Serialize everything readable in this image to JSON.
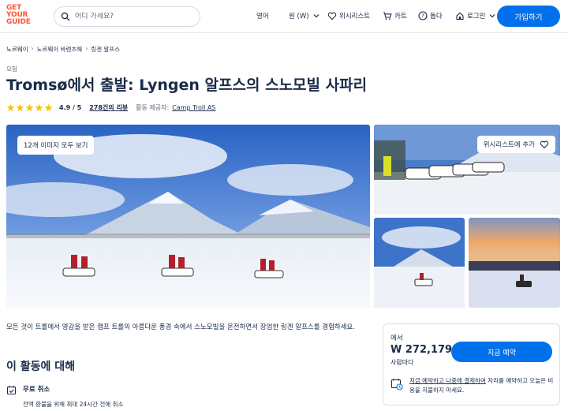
{
  "header": {
    "logo_lines": [
      "GET",
      "YOUR",
      "GUIDE"
    ],
    "search_placeholder": "어디 가세요?",
    "language": "영어",
    "currency": "원 (W)",
    "wishlist": "위시리스트",
    "cart": "카트",
    "help": "돕다",
    "login": "로그인",
    "signup": "가입하기",
    "brand_color": "#ff5533",
    "accent_color": "#0071eb"
  },
  "breadcrumb": [
    "노르웨이",
    "노르웨이 바렌츠해",
    "링겐 알프스"
  ],
  "activity": {
    "category": "모험",
    "title": "Tromsø에서 출발: Lyngen 알프스의 스노모빌 사파리",
    "rating": "4.9 / 5",
    "stars": 5,
    "reviews": "278건의 리뷰",
    "provider_label": "활동 제공자:",
    "provider": "Camp Troll AS"
  },
  "gallery": {
    "view_all": "12개 이미지 모두 보기",
    "wishlist_add": "위시리스트에 추가"
  },
  "description": "모든 것이 트롤에서 영감을 받은 캠프 트롤의 아름다운 풍경 속에서 스노모빌을 운전하면서 장엄한 링겐 알프스를 경험하세요.",
  "about": {
    "title": "이 활동에 대해",
    "features": [
      {
        "icon": "calendar-check-icon",
        "title": "무료 취소",
        "desc": "전액 환불을 위해 최대 24시간 전에 취소"
      }
    ]
  },
  "booking": {
    "from": "에서",
    "price": "W 272,179",
    "per": "사람마다",
    "cta": "지금 예약",
    "later_link": "지금 예약하고 나중에 결제하여",
    "later_rest": " 자리를 예약하고 오늘은 비용을 지불하지 마세요."
  }
}
